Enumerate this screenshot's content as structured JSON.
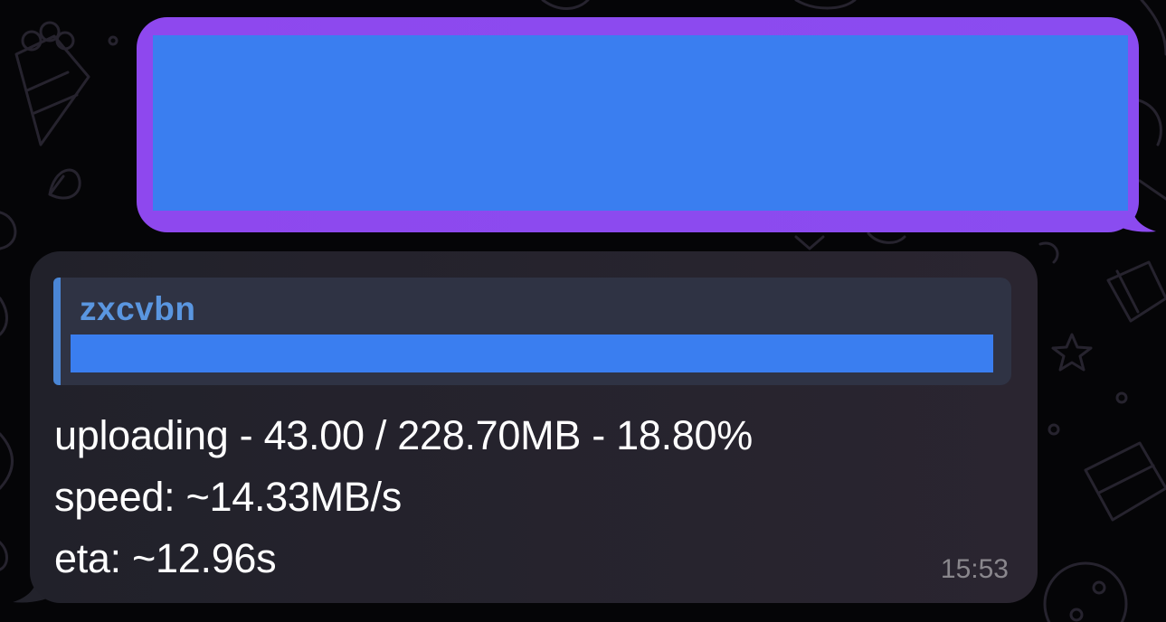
{
  "outgoing_message": {
    "color": "#3a7ef0",
    "border_color": "#8e48ee"
  },
  "incoming_message": {
    "reply": {
      "sender": "zxcvbn"
    },
    "lines": [
      "uploading - 43.00 / 228.70MB - 18.80%",
      "speed: ~14.33MB/s",
      "eta: ~12.96s"
    ],
    "time": "15:53"
  }
}
